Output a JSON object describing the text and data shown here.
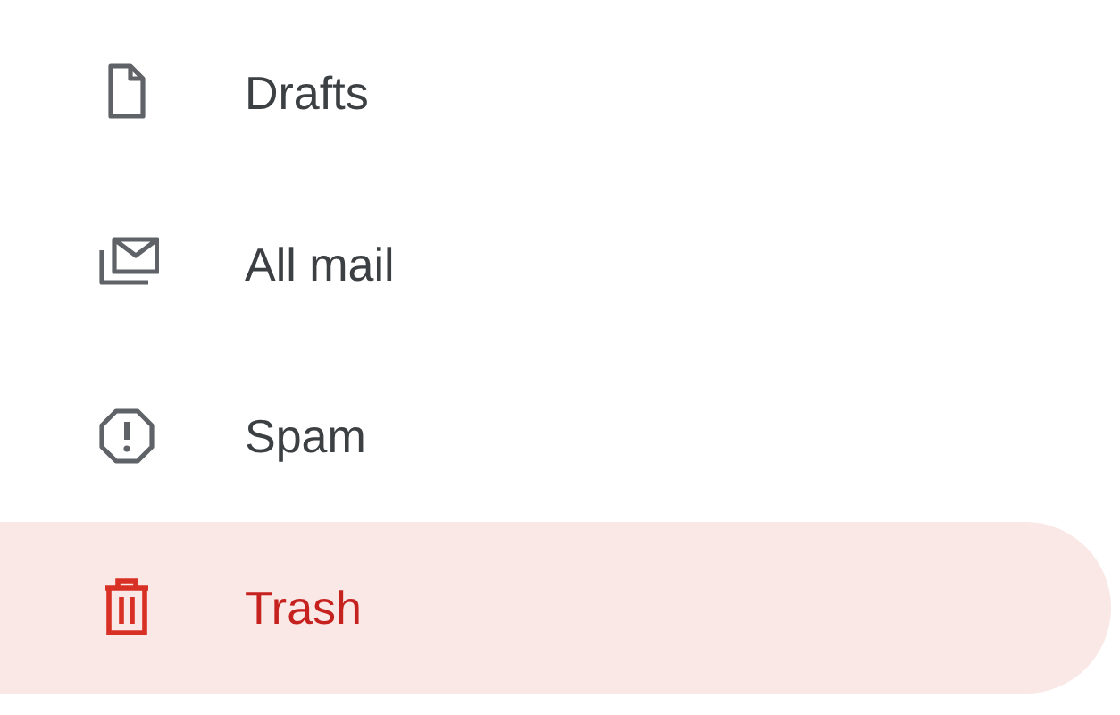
{
  "nav": [
    {
      "label": "Drafts",
      "selected": false
    },
    {
      "label": "All mail",
      "selected": false
    },
    {
      "label": "Spam",
      "selected": false
    },
    {
      "label": "Trash",
      "selected": true
    }
  ]
}
